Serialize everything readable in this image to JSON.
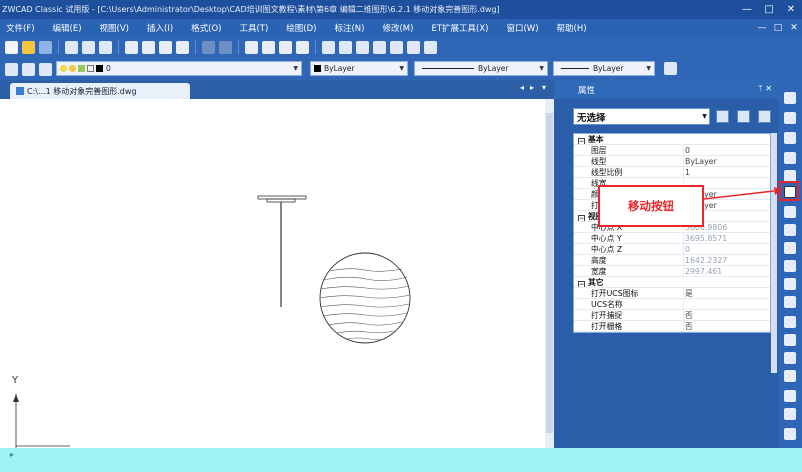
{
  "window": {
    "title": "ZWCAD Classic 试用版 - [C:\\Users\\Administrator\\Desktop\\CAD培训图文教程\\素材\\第6章 编辑二维图形\\6.2.1 移动对象完善图形.dwg]",
    "controls": [
      "—",
      "□",
      "✕"
    ]
  },
  "menu": {
    "items": [
      "文件(F)",
      "编辑(E)",
      "视图(V)",
      "插入(I)",
      "格式(O)",
      "工具(T)",
      "绘图(D)",
      "标注(N)",
      "修改(M)",
      "ET扩展工具(X)",
      "窗口(W)",
      "帮助(H)"
    ],
    "mdi_controls": [
      "—",
      "□",
      "✕"
    ]
  },
  "layer_toolbar": {
    "layer_value": "0",
    "color_value": "ByLayer",
    "linetype_value": "ByLayer",
    "lineweight_value": "ByLayer"
  },
  "document_tab": {
    "label": "C:\\...1 移动对象完善图形.dwg",
    "controls": [
      "◂",
      "▸",
      "▾",
      "✕"
    ]
  },
  "ucs": {
    "y_label": "Y"
  },
  "properties": {
    "title": "属性",
    "pin": "ᛘ ✕",
    "selection": "无选择",
    "categories": [
      {
        "name": "基本",
        "toggle": "⊟",
        "rows": [
          {
            "key": "图层",
            "value": "0"
          },
          {
            "key": "线型",
            "value": "ByLayer"
          },
          {
            "key": "线型比例",
            "value": "1"
          },
          {
            "key": "线宽",
            "value": ""
          },
          {
            "key": "颜色",
            "value": "ByLayer"
          },
          {
            "key": "打印样式",
            "value": "ByLayer"
          }
        ]
      },
      {
        "name": "视图",
        "toggle": "⊟",
        "rows": [
          {
            "key": "中心点 X",
            "value": "3606.9806"
          },
          {
            "key": "中心点 Y",
            "value": "3695.8571"
          },
          {
            "key": "中心点 Z",
            "value": "0"
          },
          {
            "key": "高度",
            "value": "1642.2327"
          },
          {
            "key": "宽度",
            "value": "2997.461"
          }
        ]
      },
      {
        "name": "其它",
        "toggle": "⊟",
        "rows": [
          {
            "key": "打开UCS图标",
            "value": "是"
          },
          {
            "key": "UCS名称",
            "value": ""
          },
          {
            "key": "打开捕捉",
            "value": "否"
          },
          {
            "key": "打开栅格",
            "value": "否"
          }
        ]
      }
    ]
  },
  "callout": {
    "label": "移动按钮"
  },
  "colors": {
    "accent_red": "#e8262b",
    "chrome_blue": "#2a62b4",
    "canvas": "#ffffff",
    "status_cyan": "#9ef4f2"
  }
}
